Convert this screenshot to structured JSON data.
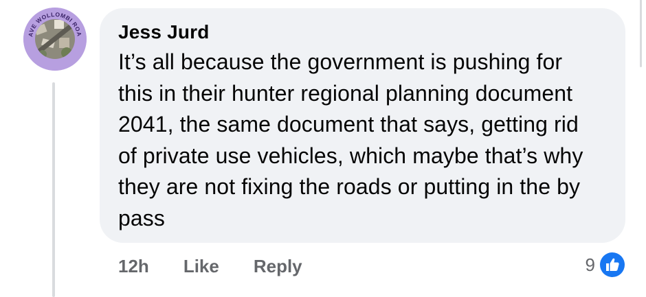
{
  "avatar": {
    "ring_text": "SAVE WOLLOMBI ROAD",
    "ring_color": "#b79fe0"
  },
  "comment": {
    "author": "Jess Jurd",
    "text": "It’s all because the government is pushing for this in their hunter regional planning document 2041, the same document that says, getting rid of private use vehicles, which maybe that’s why they are not fixing the roads or putting in the by pass"
  },
  "actions": {
    "time": "12h",
    "like_label": "Like",
    "reply_label": "Reply"
  },
  "reactions": {
    "count": "9",
    "icon": "thumbs-up-icon",
    "color": "#1877f2"
  },
  "theme": {
    "bubble_bg": "#f0f2f5",
    "meta_text": "#65676b",
    "text": "#050505"
  }
}
